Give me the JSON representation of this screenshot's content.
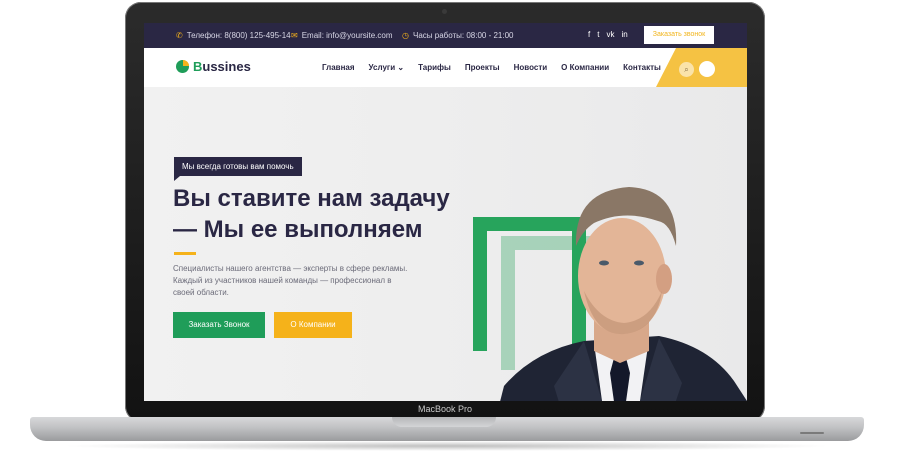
{
  "laptop": {
    "model_label": "MacBook Pro"
  },
  "topbar": {
    "phone": "Телефон: 8(800) 125-495-14",
    "email": "Email: info@yoursite.com",
    "hours": "Часы работы: 08:00 - 21:00",
    "socials": [
      "f",
      "t",
      "vk",
      "in"
    ],
    "call_button": "Заказать звонок"
  },
  "navbar": {
    "logo_first": "B",
    "logo_rest": "ussines",
    "menu": [
      "Главная",
      "Услуги",
      "Тарифы",
      "Проекты",
      "Новости",
      "О Компании",
      "Контакты"
    ],
    "dropdown_indicator": "⌄"
  },
  "hero": {
    "tag": "Мы всегда готовы вам помочь",
    "title_line1": "Вы ставите нам задачу",
    "title_line2": "— Мы ее выполняем",
    "description": "Специалисты нашего агентства — эксперты в сфере рекламы. Каждый из участников нашей команды — профессионал в своей области.",
    "button_primary": "Заказать Звонок",
    "button_secondary": "О Компании"
  },
  "colors": {
    "dark": "#2a2744",
    "green": "#1f9d59",
    "yellow": "#f5b21a"
  }
}
